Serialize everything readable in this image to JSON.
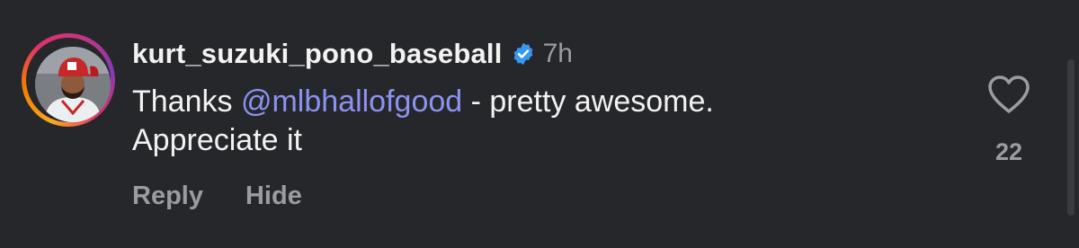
{
  "comment": {
    "username": "kurt_suzuki_pono_baseball",
    "verified": true,
    "timestamp": "7h",
    "body_prefix": "Thanks ",
    "mention": "@mlbhallofgood",
    "body_line1_rest": " - pretty awesome.",
    "body_line2": "Appreciate it",
    "likes": "22"
  },
  "actions": {
    "reply_label": "Reply",
    "hide_label": "Hide"
  },
  "icons": {
    "verified": "verified-badge-icon",
    "like": "heart-icon"
  },
  "colors": {
    "background": "#26272b",
    "mention": "#8c92f0",
    "verified_badge": "#3897f0",
    "muted_text": "#9a9ca1"
  }
}
